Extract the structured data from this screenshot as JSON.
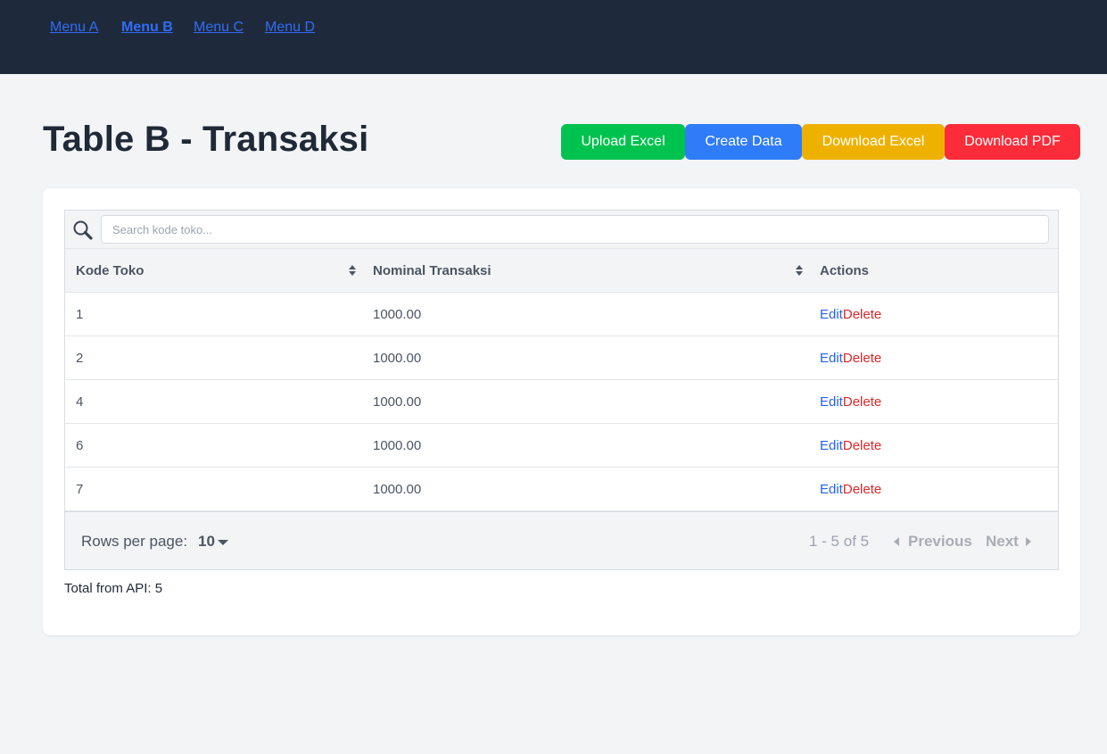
{
  "nav": {
    "items": [
      {
        "label": "Menu A",
        "active": false
      },
      {
        "label": "Menu B",
        "active": true
      },
      {
        "label": "Menu C",
        "active": false
      },
      {
        "label": "Menu D",
        "active": false
      }
    ]
  },
  "page": {
    "title": "Table B - Transaksi"
  },
  "toolbar": {
    "upload_excel": "Upload Excel",
    "create_data": "Create Data",
    "download_excel": "Download Excel",
    "download_pdf": "Download PDF"
  },
  "colors": {
    "nav_bg": "#1e293b",
    "upload": "#00c24e",
    "create": "#2f7cf8",
    "download_excel": "#efb100",
    "download_pdf": "#fc2c3a",
    "edit_link": "#2563eb",
    "delete_link": "#dc2626"
  },
  "search": {
    "placeholder": "Search kode toko...",
    "value": "",
    "icon": "search-icon"
  },
  "table": {
    "columns": [
      {
        "label": "Kode Toko",
        "sortable": true
      },
      {
        "label": "Nominal Transaksi",
        "sortable": true
      },
      {
        "label": "Actions",
        "sortable": false
      }
    ],
    "actions": {
      "edit": "Edit",
      "delete": "Delete"
    },
    "rows": [
      {
        "kode_toko": "1",
        "nominal": "1000.00"
      },
      {
        "kode_toko": "2",
        "nominal": "1000.00"
      },
      {
        "kode_toko": "4",
        "nominal": "1000.00"
      },
      {
        "kode_toko": "6",
        "nominal": "1000.00"
      },
      {
        "kode_toko": "7",
        "nominal": "1000.00"
      }
    ]
  },
  "pagination": {
    "rows_per_page_label": "Rows per page:",
    "rows_per_page_value": "10",
    "range": "1 - 5 of 5",
    "previous": "Previous",
    "next": "Next"
  },
  "footer": {
    "total_text": "Total from API: 5"
  }
}
